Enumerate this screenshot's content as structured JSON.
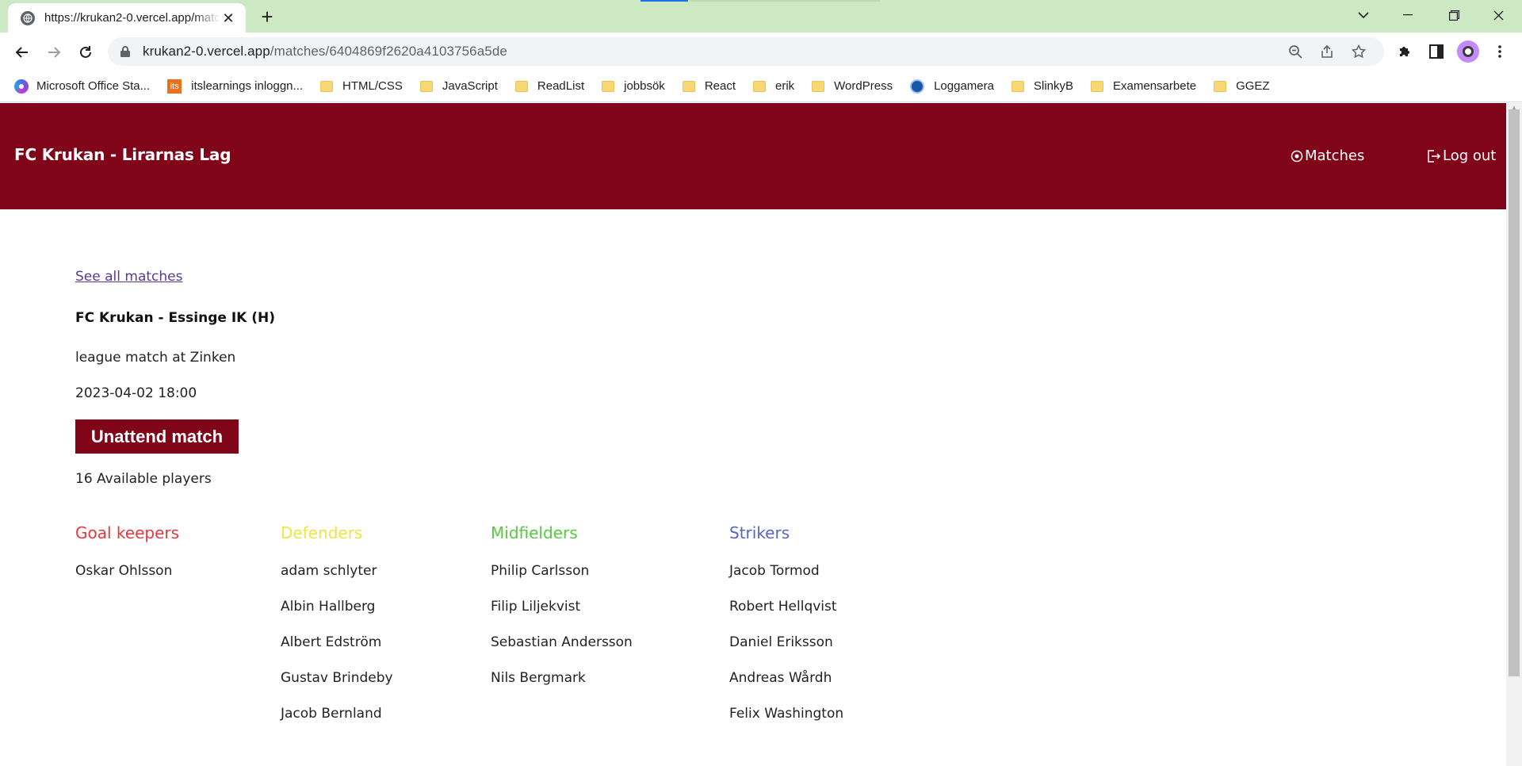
{
  "browser": {
    "tab_title": "https://krukan2-0.vercel.app/matches/6404869f2620a4103756a5de",
    "url_host": "krukan2-0.vercel.app",
    "url_path": "/matches/6404869f2620a4103756a5de",
    "bookmarks": [
      {
        "label": "Microsoft Office Sta...",
        "icon": "office-icon"
      },
      {
        "label": "itslearnings inloggn...",
        "icon": "itslearning-icon",
        "icon_text": "its"
      },
      {
        "label": "HTML/CSS",
        "icon": "folder-icon"
      },
      {
        "label": "JavaScript",
        "icon": "folder-icon"
      },
      {
        "label": "ReadList",
        "icon": "folder-icon"
      },
      {
        "label": "jobbsök",
        "icon": "folder-icon"
      },
      {
        "label": "React",
        "icon": "folder-icon"
      },
      {
        "label": "erik",
        "icon": "folder-icon"
      },
      {
        "label": "WordPress",
        "icon": "folder-icon"
      },
      {
        "label": "Loggamera",
        "icon": "loggamera-icon"
      },
      {
        "label": "SlinkyB",
        "icon": "folder-icon"
      },
      {
        "label": "Examensarbete",
        "icon": "folder-icon"
      },
      {
        "label": "GGEZ",
        "icon": "folder-icon"
      }
    ]
  },
  "header": {
    "title": "FC Krukan - Lirarnas Lag",
    "nav_matches": "Matches",
    "nav_logout": "Log out",
    "color": "#800519"
  },
  "match": {
    "back_link": "See all matches",
    "title": "FC Krukan - Essinge IK (H)",
    "type": "league match at Zinken",
    "datetime": "2023-04-02 18:00",
    "attend_button": "Unattend match",
    "available": "16 Available players"
  },
  "positions": [
    {
      "name": "Goal keepers",
      "color": "#e2393f",
      "players": [
        "Oskar Ohlsson"
      ]
    },
    {
      "name": "Defenders",
      "color": "#f0e442",
      "players": [
        "adam schlyter",
        "Albin Hallberg",
        "Albert Edström",
        "Gustav Brindeby",
        "Jacob Bernland"
      ]
    },
    {
      "name": "Midfielders",
      "color": "#56c93f",
      "players": [
        "Philip Carlsson",
        "Filip Liljekvist",
        "Sebastian Andersson",
        "Nils Bergmark"
      ]
    },
    {
      "name": "Strikers",
      "color": "#5a62c7",
      "players": [
        "Jacob Tormod",
        "Robert Hellqvist",
        "Daniel Eriksson",
        "Andreas Wårdh",
        "Felix Washington"
      ]
    }
  ]
}
